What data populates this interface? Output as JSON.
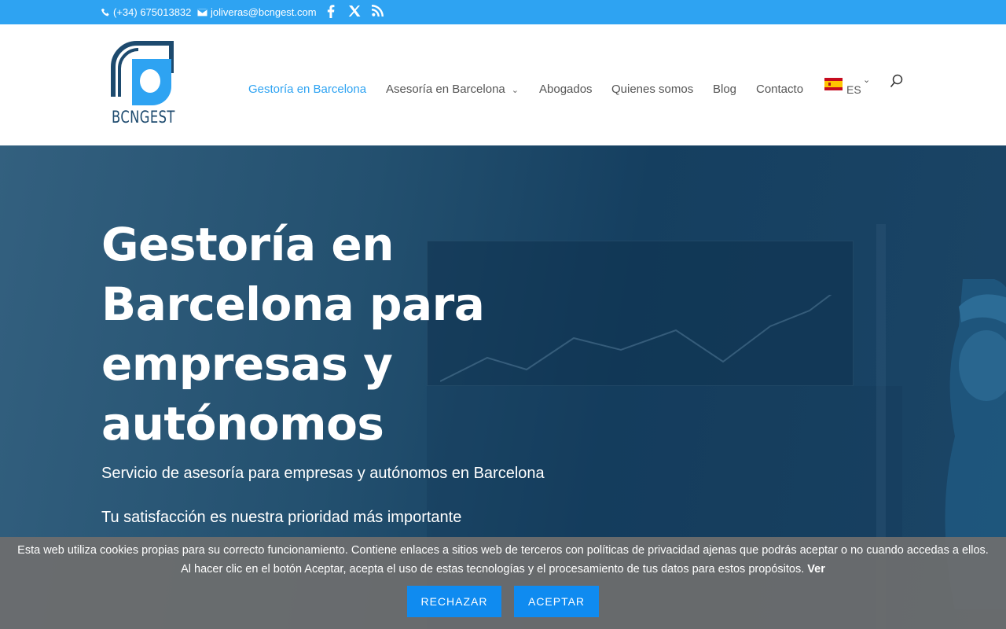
{
  "topbar": {
    "phone": "(+34) 675013832",
    "email": "joliveras@bcngest.com",
    "social_icons": [
      "facebook-icon",
      "x-icon",
      "rss-icon"
    ]
  },
  "header": {
    "logo_text": "BCNGEST",
    "nav": [
      {
        "label": "Gestoría en Barcelona",
        "active": true
      },
      {
        "label": "Asesoría en Barcelona",
        "has_dropdown": true
      },
      {
        "label": "Abogados"
      },
      {
        "label": "Quienes somos"
      },
      {
        "label": "Blog"
      },
      {
        "label": "Contacto"
      }
    ],
    "language": "ES"
  },
  "hero": {
    "title": "Gestoría en Barcelona para empresas y autónomos",
    "subtitle": "Servicio de asesoría para empresas y autónomos en Barcelona",
    "tagline": "Tu satisfacción es nuestra prioridad más importante"
  },
  "cookie": {
    "text_line1": "Esta web utiliza cookies propias para su correcto funcionamiento. Contiene enlaces a sitios web de terceros con políticas de privacidad ajenas que podrás aceptar o no cuando accedas a ellos.",
    "text_line2": "Al hacer clic en el botón Aceptar, acepta el uso de estas tecnologías y el procesamiento de tus datos para estos propósitos.",
    "link": "Ver",
    "reject_label": "RECHAZAR",
    "accept_label": "ACEPTAR"
  },
  "colors": {
    "accent": "#2ea3f2",
    "button": "#0f8bf0",
    "hero_dark": "#153f60"
  }
}
